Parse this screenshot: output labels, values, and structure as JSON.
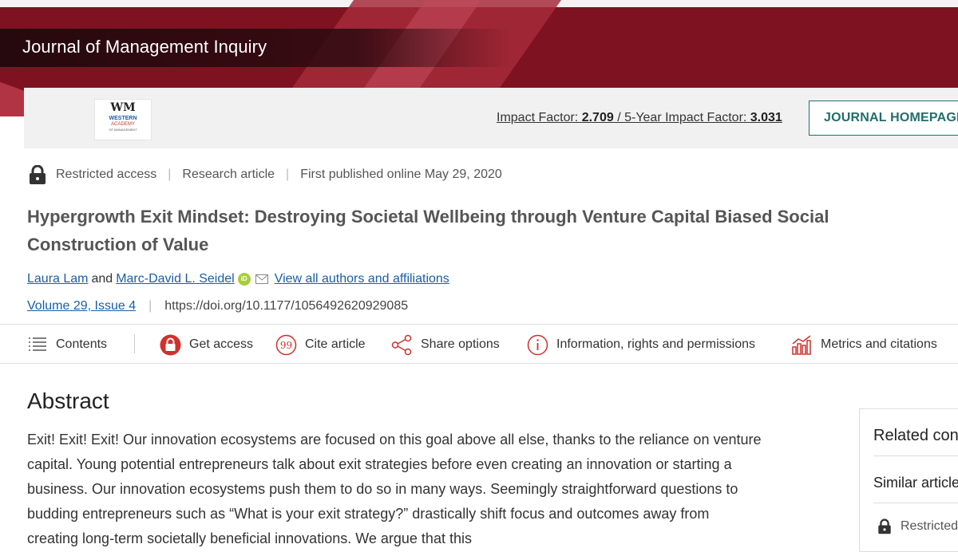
{
  "journal": {
    "title": "Journal of Management Inquiry",
    "logo_text": {
      "mark": "WM",
      "line1": "WESTERN",
      "line2": "ACADEMY",
      "line3": "OF MANAGEMENT"
    }
  },
  "header": {
    "impact_label": "Impact Factor: ",
    "impact_value": "2.709",
    "five_year_label": " / 5-Year Impact Factor: ",
    "five_year_value": "3.031",
    "homepage_button": "JOURNAL HOMEPAGE"
  },
  "meta": {
    "access": "Restricted access",
    "type": "Research article",
    "published": "First published online May 29, 2020"
  },
  "article": {
    "title": "Hypergrowth Exit Mindset: Destroying Societal Wellbeing through Venture Capital Biased Social Construction of Value",
    "author1": "Laura Lam",
    "and": "and",
    "author2": "Marc-David L. Seidel",
    "view_all": "View all authors and affiliations",
    "volume": "Volume 29, Issue 4",
    "doi": "https://doi.org/10.1177/1056492620929085"
  },
  "toolbar": {
    "contents": "Contents",
    "get_access": "Get access",
    "cite": "Cite article",
    "share": "Share options",
    "info": "Information, rights and permissions",
    "metrics": "Metrics and citations"
  },
  "abstract": {
    "heading": "Abstract",
    "text": "Exit! Exit! Exit! Our innovation ecosystems are focused on this goal above all else, thanks to the reliance on venture capital. Young potential entrepreneurs talk about exit strategies before even creating an innovation or starting a business. Our innovation ecosystems push them to do so in many ways. Seemingly straightforward questions to budding entrepreneurs such as “What is your exit strategy?” drastically shift focus and outcomes away from creating long-term societally beneficial innovations. We argue that this"
  },
  "sidebar": {
    "related": "Related content",
    "similar": "Similar articles:",
    "restricted": "Restricted access"
  },
  "colors": {
    "banner": "#7e1220",
    "link": "#1a5ea8",
    "teal": "#1f6f6b",
    "icon_red": "#d0312d",
    "orcid": "#a6ce39"
  }
}
